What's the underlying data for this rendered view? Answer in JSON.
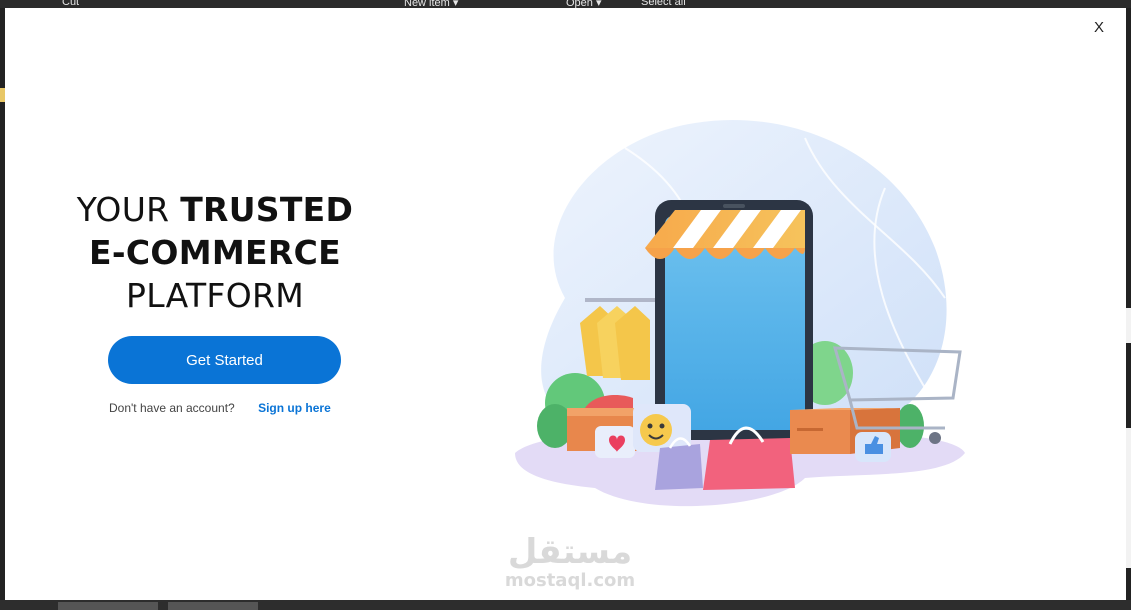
{
  "background_window": {
    "ribbon_items": [
      "Cut",
      "New item ▾",
      "Open ▾",
      "Select all"
    ]
  },
  "modal": {
    "close_label": "X",
    "headline": {
      "line1_regular": "YOUR ",
      "line1_bold": "TRUSTED",
      "line2_bold": "E-COMMERCE",
      "line3_regular": "PLATFORM"
    },
    "cta_label": "Get Started",
    "signup_prompt": "Don't have an account?",
    "signup_link": "Sign up here"
  },
  "watermark": {
    "arabic": "مستقل",
    "latin": "mostaql.com"
  },
  "colors": {
    "accent": "#0a74d6",
    "modal_bg": "#ffffff"
  },
  "icons": [
    "close-icon",
    "shopping-phone-illustration"
  ]
}
